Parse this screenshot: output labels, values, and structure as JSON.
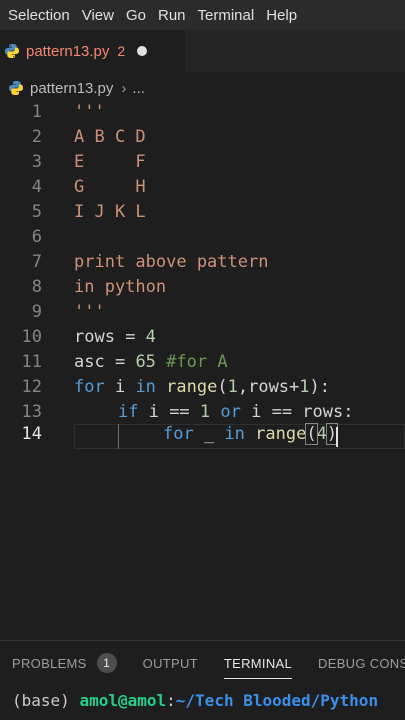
{
  "menu": [
    "Selection",
    "View",
    "Go",
    "Run",
    "Terminal",
    "Help"
  ],
  "tab": {
    "filename": "pattern13.py",
    "problem_count": "2"
  },
  "breadcrumb": {
    "file": "pattern13.py",
    "more": "..."
  },
  "code_lines": [
    {
      "n": "1",
      "text": "'''"
    },
    {
      "n": "2",
      "text": "A B C D"
    },
    {
      "n": "3",
      "text": "E     F"
    },
    {
      "n": "4",
      "text": "G     H"
    },
    {
      "n": "5",
      "text": "I J K L"
    },
    {
      "n": "6",
      "text": ""
    },
    {
      "n": "7",
      "text": "print above pattern"
    },
    {
      "n": "8",
      "text": "in python"
    },
    {
      "n": "9",
      "text": "'''"
    },
    {
      "n": "10",
      "t": [
        "rows",
        " = ",
        "4"
      ]
    },
    {
      "n": "11",
      "t": [
        "asc",
        " = ",
        "65",
        " #for A"
      ]
    },
    {
      "n": "12",
      "t": [
        "for",
        " i ",
        "in",
        " ",
        "range",
        "(",
        "1",
        ",rows+",
        "1",
        "):"
      ]
    },
    {
      "n": "13",
      "t": [
        "if",
        " i == ",
        "1",
        " ",
        "or",
        " i == rows:"
      ]
    },
    {
      "n": "14",
      "t": [
        "for",
        " _ ",
        "in",
        " ",
        "range",
        "(",
        "4",
        ")"
      ]
    }
  ],
  "panel": {
    "tabs": [
      "PROBLEMS",
      "OUTPUT",
      "TERMINAL",
      "DEBUG CONSOLE"
    ],
    "problems_badge": "1",
    "active": "TERMINAL"
  },
  "terminal": {
    "env": "(base)",
    "user": "amol@amol",
    "sep": ":",
    "path": "~/Tech Blooded/Python"
  }
}
